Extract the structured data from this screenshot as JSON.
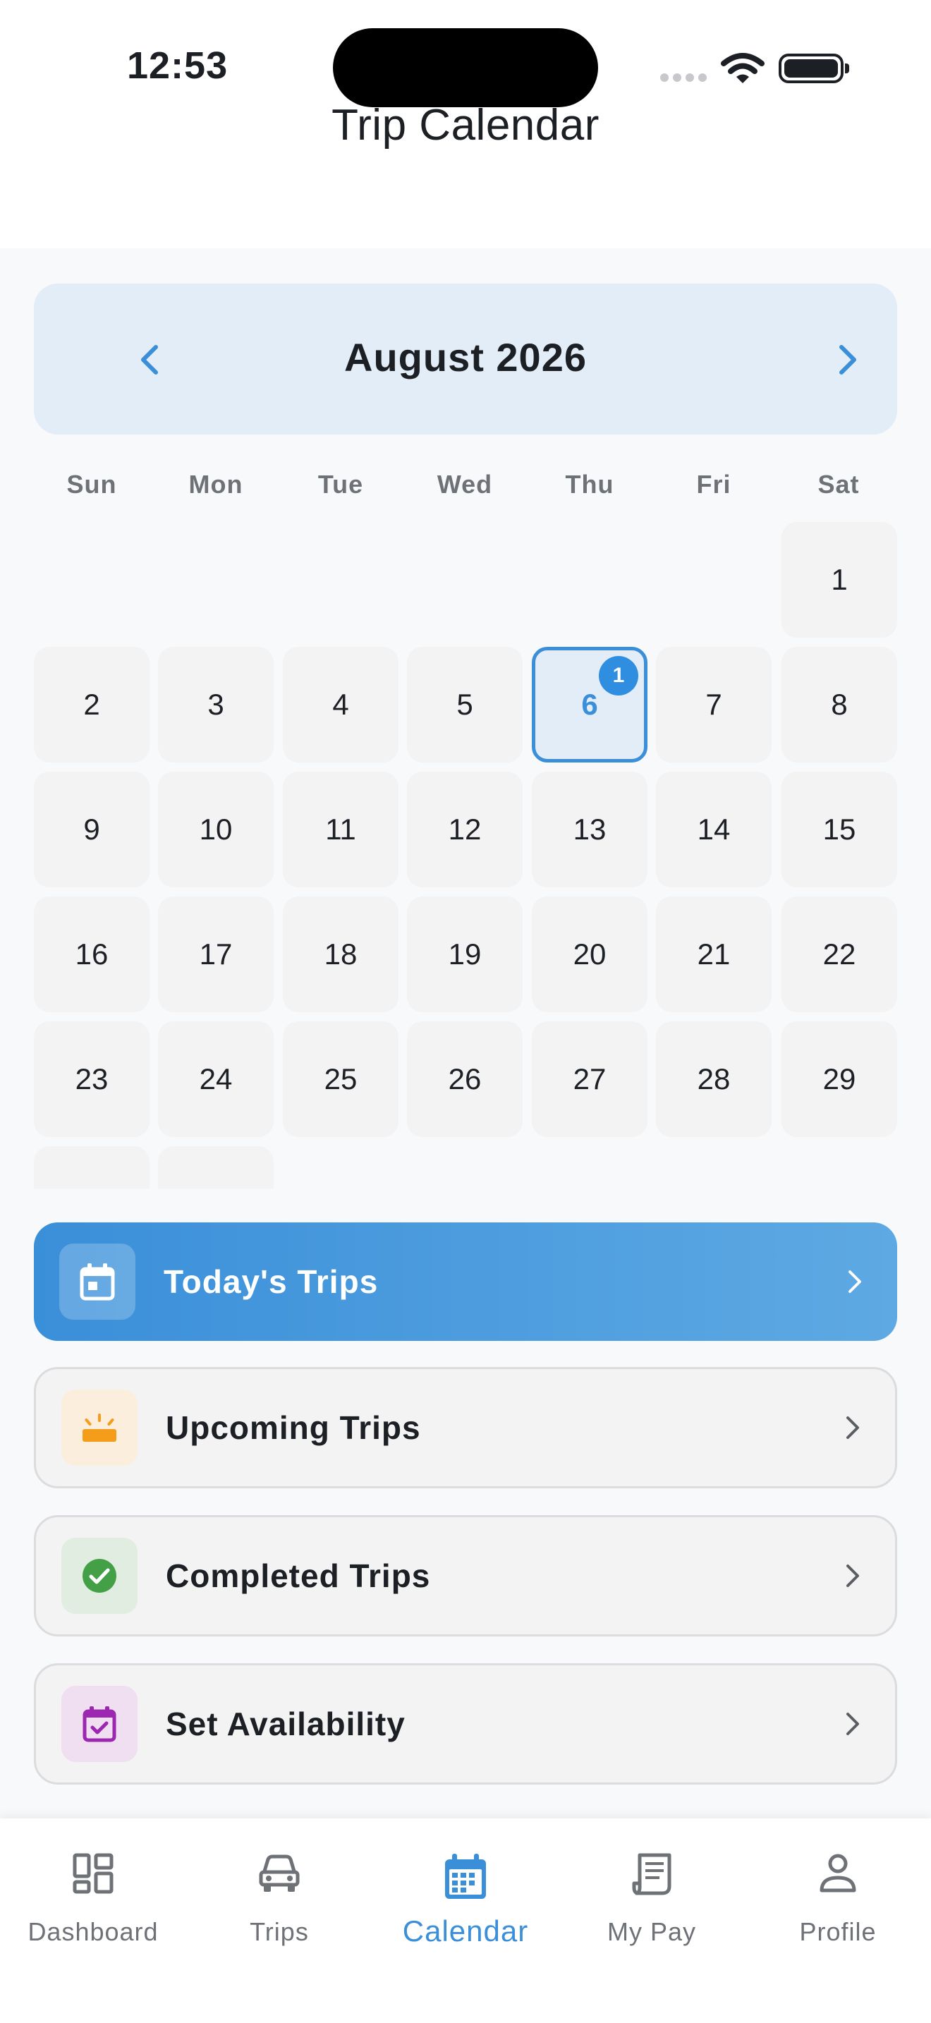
{
  "status_bar": {
    "time": "12:53"
  },
  "header": {
    "title": "Trip Calendar"
  },
  "calendar": {
    "month_label": "August 2026",
    "weekdays": [
      "Sun",
      "Mon",
      "Tue",
      "Wed",
      "Thu",
      "Fri",
      "Sat"
    ],
    "selected_day": "6",
    "selected_day_badge": "1",
    "days": [
      "1",
      "2",
      "3",
      "4",
      "5",
      "6",
      "7",
      "8",
      "9",
      "10",
      "11",
      "12",
      "13",
      "14",
      "15",
      "16",
      "17",
      "18",
      "19",
      "20",
      "21",
      "22",
      "23",
      "24",
      "25",
      "26",
      "27",
      "28",
      "29"
    ]
  },
  "actions": {
    "today": "Today's Trips",
    "upcoming": "Upcoming Trips",
    "completed": "Completed Trips",
    "availability": "Set Availability"
  },
  "nav": {
    "dashboard": "Dashboard",
    "trips": "Trips",
    "calendar": "Calendar",
    "my_pay": "My Pay",
    "profile": "Profile"
  },
  "colors": {
    "accent": "#3b8fd8",
    "upcoming_icon": "#f59c1a",
    "completed_icon": "#43a047",
    "availability_icon": "#9c27b0"
  },
  "icons": {
    "today": "calendar-day-icon",
    "upcoming": "sunrise-icon",
    "completed": "check-circle-icon",
    "availability": "calendar-check-icon"
  }
}
